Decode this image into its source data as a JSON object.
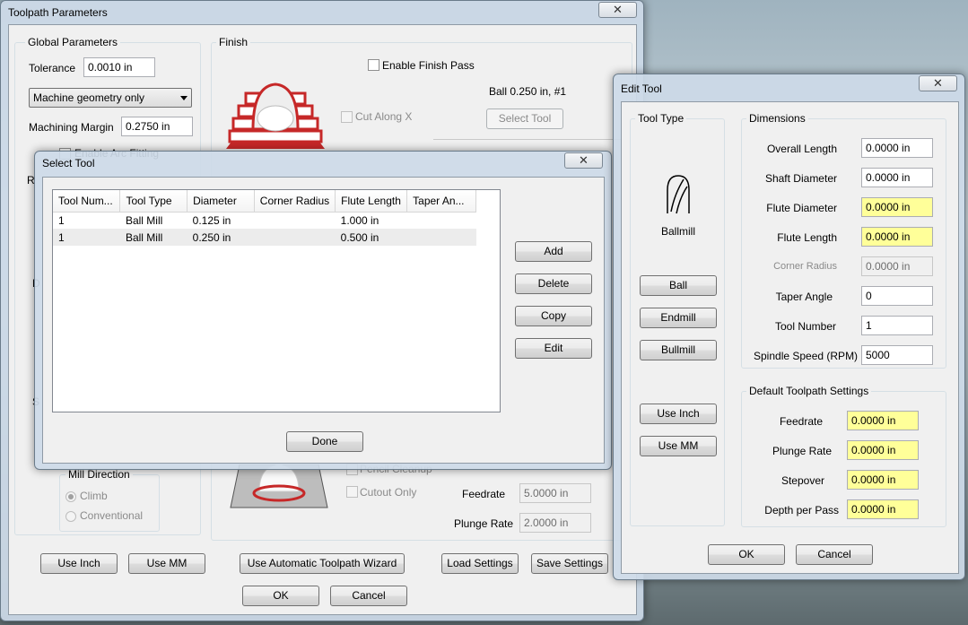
{
  "toolpath": {
    "title": "Toolpath Parameters",
    "close": "✕",
    "global_label": "Global Parameters",
    "tolerance_label": "Tolerance",
    "tolerance_value": "0.0010 in",
    "geometry_select": "Machine geometry only",
    "margin_label": "Machining Margin",
    "margin_value": "0.2750 in",
    "arc_fitting": "Enable Arc Fitting",
    "left_fragment_1": "R",
    "left_fragment_2": "D",
    "left_fragment_3": "S",
    "finish_label": "Finish",
    "enable_finish": "Enable Finish Pass",
    "tool_info": "Ball 0.250 in, #1",
    "cut_along_x": "Cut Along X",
    "select_tool": "Select Tool",
    "pencil_cleanup": "Pencil Cleanup",
    "cutout_only": "Cutout Only",
    "feedrate_label": "Feedrate",
    "feedrate_value": "5.0000 in",
    "plunge_label": "Plunge Rate",
    "plunge_value": "2.0000 in",
    "mill_direction": "Mill Direction",
    "climb": "Climb",
    "conventional": "Conventional",
    "use_inch": "Use Inch",
    "use_mm": "Use MM",
    "wizard": "Use Automatic Toolpath Wizard",
    "load_settings": "Load Settings",
    "save_settings": "Save Settings",
    "ok": "OK",
    "cancel": "Cancel"
  },
  "select_tool": {
    "title": "Select Tool",
    "close": "✕",
    "columns": [
      "Tool Num...",
      "Tool Type",
      "Diameter",
      "Corner Radius",
      "Flute Length",
      "Taper An..."
    ],
    "rows": [
      [
        "1",
        "Ball Mill",
        "0.125 in",
        "",
        "1.000 in",
        ""
      ],
      [
        "1",
        "Ball Mill",
        "0.250 in",
        "",
        "0.500 in",
        ""
      ]
    ],
    "add": "Add",
    "delete": "Delete",
    "copy": "Copy",
    "edit": "Edit",
    "done": "Done"
  },
  "edit_tool": {
    "title": "Edit Tool",
    "close": "✕",
    "tool_type_label": "Tool Type",
    "tool_name": "Ballmill",
    "ball": "Ball",
    "endmill": "Endmill",
    "bullmill": "Bullmill",
    "use_inch": "Use Inch",
    "use_mm": "Use MM",
    "dimensions_label": "Dimensions",
    "overall_length_label": "Overall Length",
    "overall_length": "0.0000 in",
    "shaft_diameter_label": "Shaft Diameter",
    "shaft_diameter": "0.0000 in",
    "flute_diameter_label": "Flute Diameter",
    "flute_diameter": "0.0000 in",
    "flute_length_label": "Flute Length",
    "flute_length": "0.0000 in",
    "corner_radius_label": "Corner Radius",
    "corner_radius": "0.0000 in",
    "taper_angle_label": "Taper Angle",
    "taper_angle": "0",
    "tool_number_label": "Tool Number",
    "tool_number": "1",
    "spindle_label": "Spindle Speed (RPM)",
    "spindle": "5000",
    "defaults_label": "Default Toolpath Settings",
    "feedrate_label": "Feedrate",
    "feedrate": "0.0000 in",
    "plunge_label": "Plunge Rate",
    "plunge": "0.0000 in",
    "stepover_label": "Stepover",
    "stepover": "0.0000 in",
    "depth_label": "Depth per Pass",
    "depth": "0.0000 in",
    "ok": "OK",
    "cancel": "Cancel"
  },
  "colors": {
    "highlight_field": "#ffff99",
    "preview_red": "#c62828"
  }
}
